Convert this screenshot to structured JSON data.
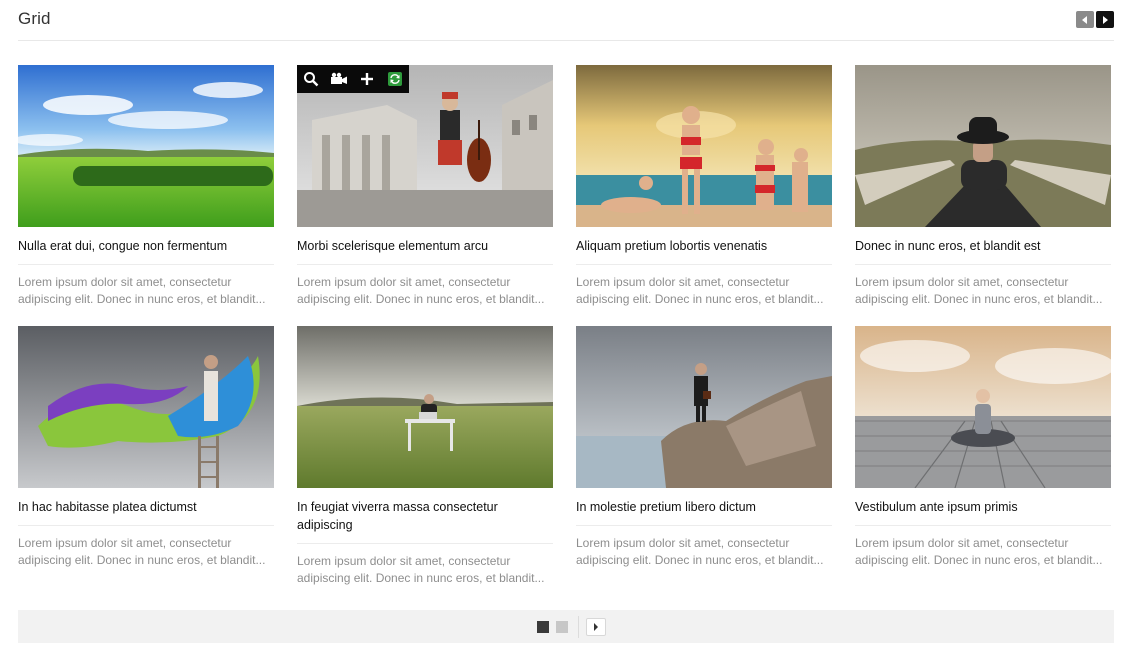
{
  "header": {
    "title": "Grid",
    "prev_icon": "arrow-left-icon",
    "next_icon": "arrow-right-icon"
  },
  "toolbar": {
    "icons": [
      "search-icon",
      "video-camera-icon",
      "plus-icon",
      "green-refresh-icon"
    ]
  },
  "items": [
    {
      "title": "Nulla erat dui, congue non fermentum",
      "desc": "Lorem ipsum dolor sit amet, consectetur adipiscing elit. Donec in nunc eros, et blandit..."
    },
    {
      "title": "Morbi scelerisque elementum arcu",
      "desc": "Lorem ipsum dolor sit amet, consectetur adipiscing elit. Donec in nunc eros, et blandit..."
    },
    {
      "title": "Aliquam pretium lobortis venenatis",
      "desc": "Lorem ipsum dolor sit amet, consectetur adipiscing elit. Donec in nunc eros, et blandit..."
    },
    {
      "title": "Donec in nunc eros, et blandit est",
      "desc": "Lorem ipsum dolor sit amet, consectetur adipiscing elit. Donec in nunc eros, et blandit..."
    },
    {
      "title": "In hac habitasse platea dictumst",
      "desc": "Lorem ipsum dolor sit amet, consectetur adipiscing elit. Donec in nunc eros, et blandit..."
    },
    {
      "title": "In feugiat viverra massa consectetur adipiscing",
      "desc": "Lorem ipsum dolor sit amet, consectetur adipiscing elit. Donec in nunc eros, et blandit..."
    },
    {
      "title": "In molestie pretium libero dictum",
      "desc": "Lorem ipsum dolor sit amet, consectetur adipiscing elit. Donec in nunc eros, et blandit..."
    },
    {
      "title": "Vestibulum ante ipsum primis",
      "desc": "Lorem ipsum dolor sit amet, consectetur adipiscing elit. Donec in nunc eros, et blandit..."
    }
  ],
  "pagination": {
    "current_page": 1,
    "total_pages": 2,
    "next_icon": "arrow-right-icon"
  },
  "colors": {
    "nav_prev": "#8a8a8a",
    "nav_next": "#111111",
    "pager_active": "#3a3a3a",
    "pager_inactive": "#c7c7c7",
    "toolbar_bg": "#0a0a0a",
    "toolbar_accent": "#2e9b3c"
  }
}
